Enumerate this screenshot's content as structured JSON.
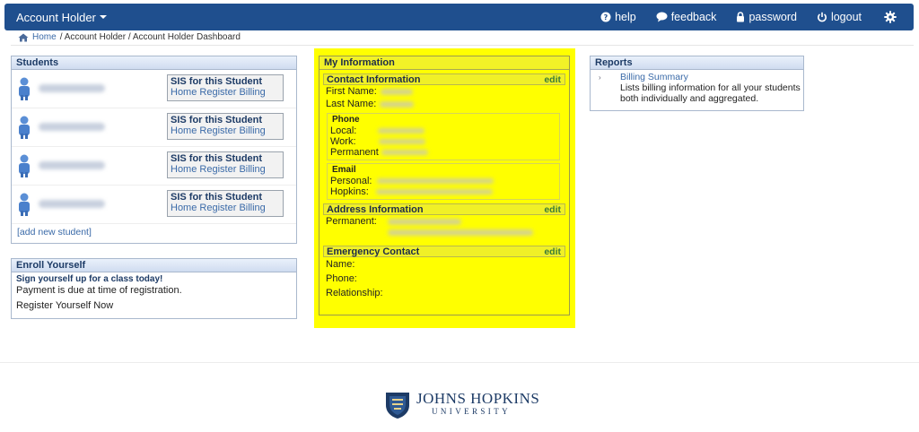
{
  "nav": {
    "brand": "Account Holder",
    "links": {
      "help": "help",
      "feedback": "feedback",
      "password": "password",
      "logout": "logout"
    }
  },
  "breadcrumb": {
    "home": "Home",
    "trail": " / Account Holder / Account Holder Dashboard"
  },
  "students": {
    "title": "Students",
    "rows": [
      {
        "sis_title": "SIS for this Student",
        "home": "Home",
        "register": "Register",
        "billing": "Billing"
      },
      {
        "sis_title": "SIS for this Student",
        "home": "Home",
        "register": "Register",
        "billing": "Billing"
      },
      {
        "sis_title": "SIS for this Student",
        "home": "Home",
        "register": "Register",
        "billing": "Billing"
      },
      {
        "sis_title": "SIS for this Student",
        "home": "Home",
        "register": "Register",
        "billing": "Billing"
      }
    ],
    "add_new": "[add new student]"
  },
  "enroll": {
    "title": "Enroll Yourself",
    "signup": "Sign yourself up for a class today!",
    "payment": "Payment is due at time of registration.",
    "register_now": "Register Yourself Now"
  },
  "my_info": {
    "title": "My Information",
    "contact": {
      "title": "Contact Information",
      "edit": "edit",
      "first_name": "First Name:",
      "last_name": "Last Name:",
      "phone_title": "Phone",
      "local": "Local:",
      "work": "Work:",
      "permanent": "Permanent",
      "email_title": "Email",
      "personal": "Personal:",
      "hopkins": "Hopkins:"
    },
    "address": {
      "title": "Address Information",
      "edit": "edit",
      "permanent": "Permanent:"
    },
    "emergency": {
      "title": "Emergency Contact",
      "edit": "edit",
      "name": "Name:",
      "phone": "Phone:",
      "relationship": "Relationship:"
    }
  },
  "reports": {
    "title": "Reports",
    "link": "Billing Summary",
    "desc1": "Lists billing information for all your students",
    "desc2": "both individually and aggregated."
  },
  "footer": {
    "logo_line1": "JOHNS HOPKINS",
    "logo_line2": "UNIVERSITY"
  },
  "colors": {
    "nav_bg": "#1f4f8e",
    "highlight": "#ffff00",
    "link": "#3a6aa8"
  }
}
